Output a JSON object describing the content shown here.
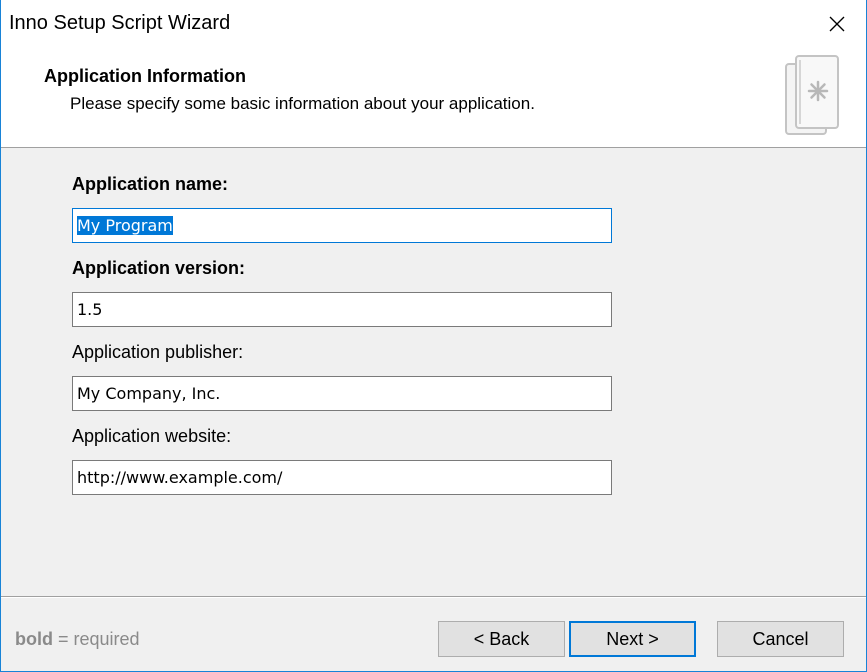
{
  "window": {
    "title": "Inno Setup Script Wizard",
    "close_icon": "close-icon"
  },
  "header": {
    "title": "Application Information",
    "subtitle": "Please specify some basic information about your application.",
    "icon": "document-star-icon"
  },
  "form": {
    "fields": [
      {
        "label": "Application name:",
        "value": "My Program",
        "required": true
      },
      {
        "label": "Application version:",
        "value": "1.5",
        "required": true
      },
      {
        "label": "Application publisher:",
        "value": "My Company, Inc.",
        "required": false
      },
      {
        "label": "Application website:",
        "value": "http://www.example.com/",
        "required": false
      }
    ]
  },
  "footer": {
    "required_bold": "bold",
    "required_text": " = required",
    "back_label": "< Back",
    "next_label": "Next >",
    "cancel_label": "Cancel"
  },
  "colors": {
    "accent": "#0078d7",
    "window_border": "#1883d7",
    "panel_background": "#f0f0f0"
  }
}
